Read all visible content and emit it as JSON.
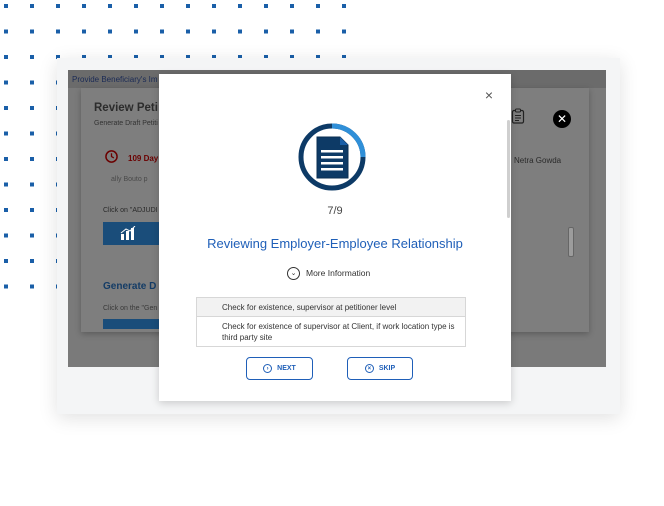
{
  "background_app": {
    "top_bar_text": "Provide Beneficiary's Im",
    "panel_title": "Review Peti",
    "panel_subtitle": "Generate Draft Petiti",
    "days_remaining": "109 Day",
    "faded_text": "ally Bouto p",
    "click_instruction": "Click on \"ADJUDI",
    "generate_heading": "Generate D",
    "generate_instruction": "Click on the \"Gen",
    "user_name": "Netra Gowda",
    "close_glyph": "✕"
  },
  "modal": {
    "close_glyph": "×",
    "icon": "document-icon",
    "step_counter": "7/9",
    "title": "Reviewing Employer-Employee Relationship",
    "more_info_label": "More Information",
    "checklist": [
      "Check for existence, supervisor at petitioner level",
      "Check for existence of supervisor at Client, if work location type is third party site"
    ],
    "next_label": "NEXT",
    "skip_label": "SKIP"
  },
  "colors": {
    "accent": "#1f5fb8",
    "dots": "#1a5fa8",
    "icon_dark": "#0d3a66",
    "icon_ring": "#2f8fd8"
  }
}
